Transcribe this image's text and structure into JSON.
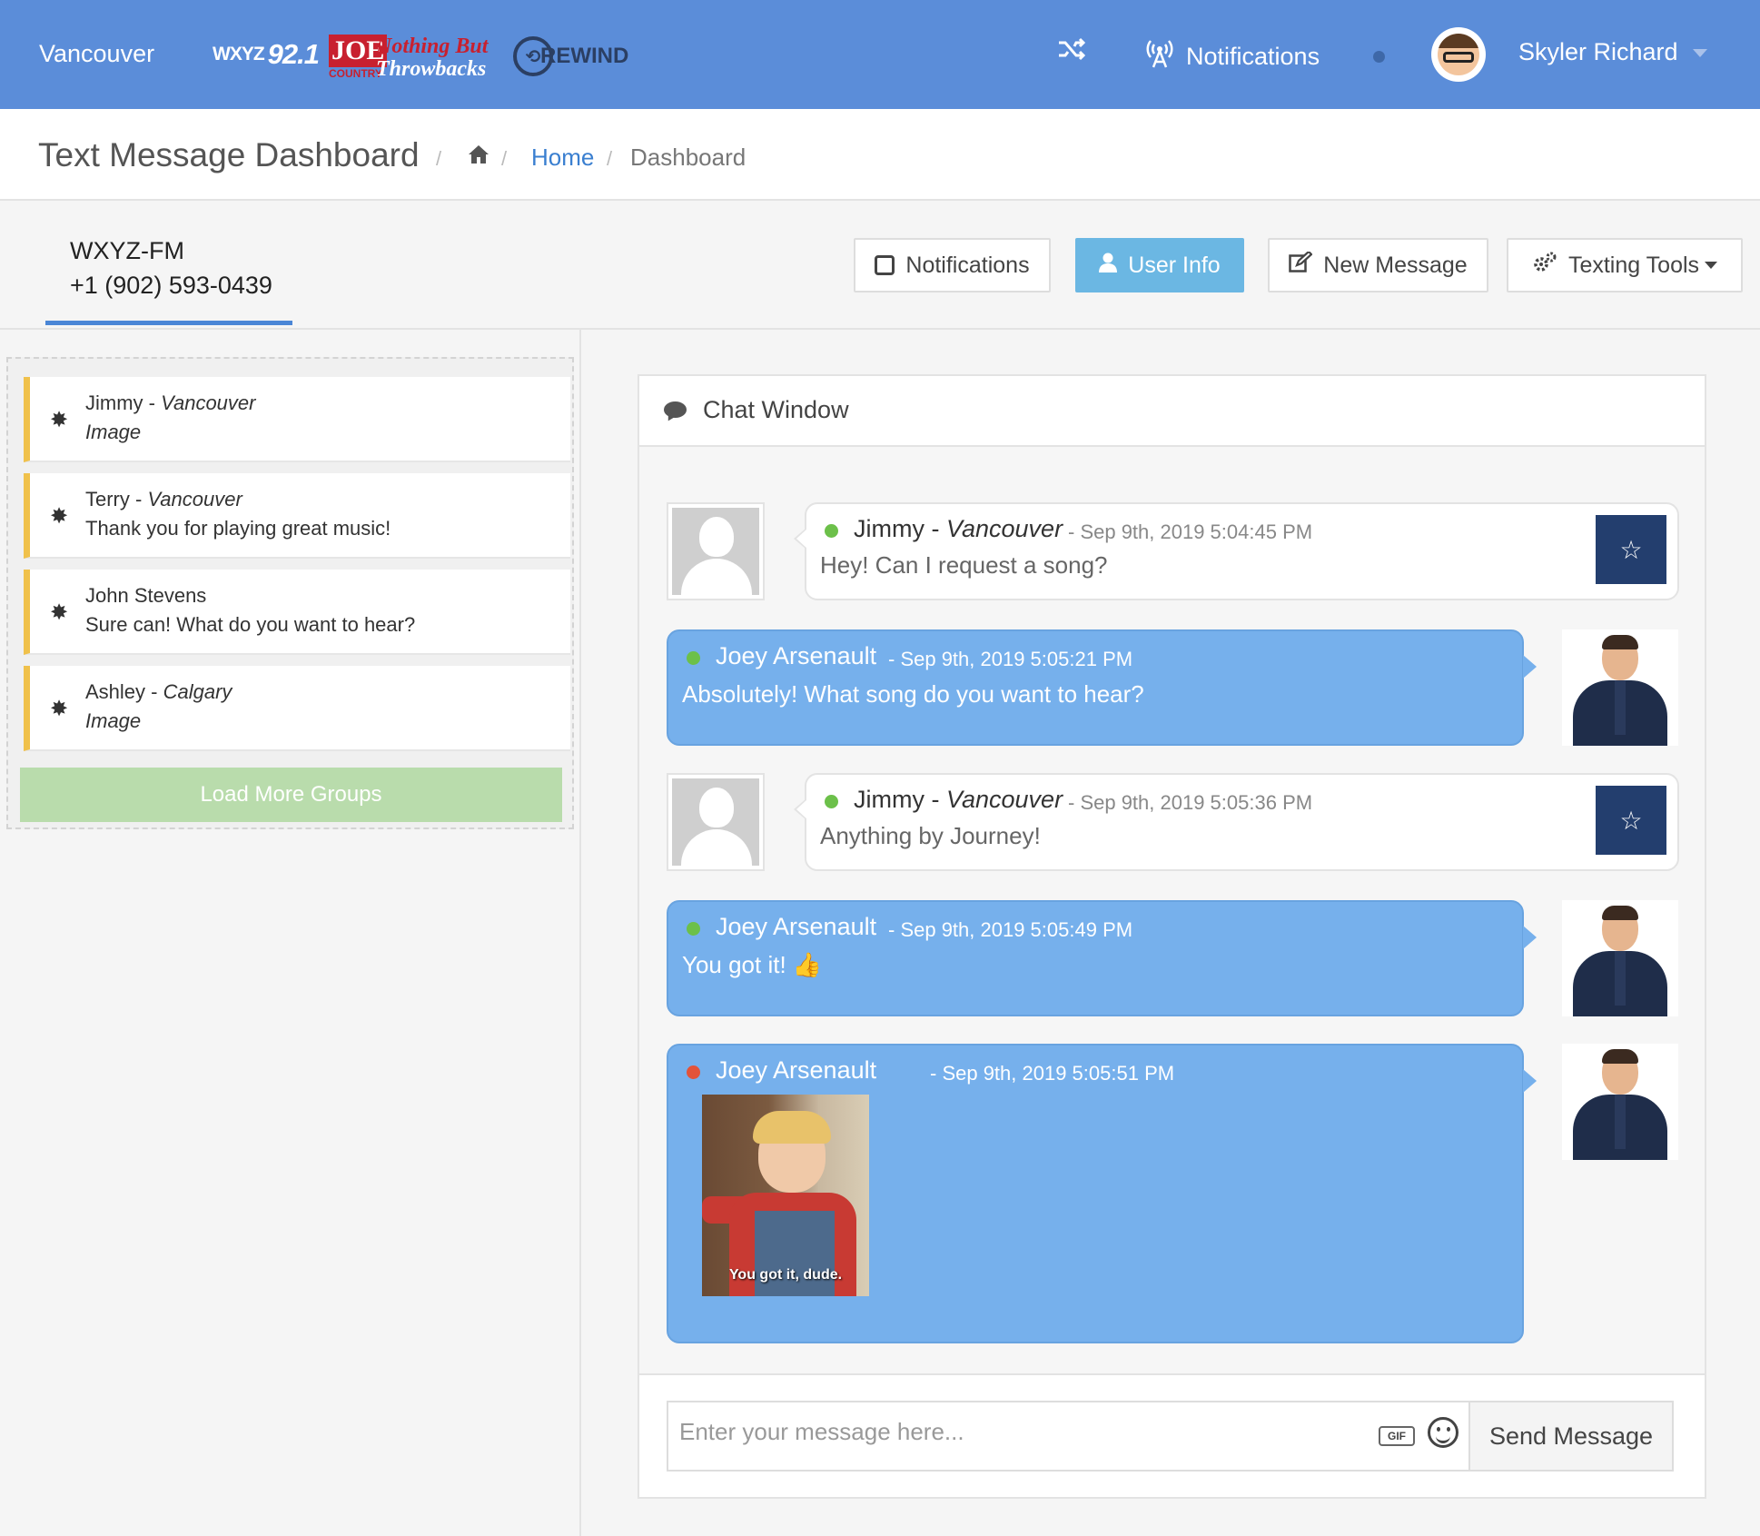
{
  "topbar": {
    "city": "Vancouver",
    "logos": {
      "wxyz": {
        "prefix": "WXYZ",
        "freq": "92.1"
      },
      "joe": {
        "brand": "JOE",
        "sub": "COUNTRY",
        "line1": "Nothing But",
        "line2": "Throwbacks"
      },
      "rewind": {
        "mark": "⟲",
        "name": "REWIND"
      }
    },
    "shuffle_icon": "shuffle-icon",
    "notifications_label": "Notifications",
    "notifications_icon": "broadcast-icon",
    "user_name": "Skyler Richard",
    "colors": {
      "bar": "#5b8dd9"
    }
  },
  "header": {
    "title": "Text Message Dashboard",
    "breadcrumb": {
      "home": "Home",
      "current": "Dashboard"
    }
  },
  "station": {
    "name": "WXYZ-FM",
    "phone": "+1 (902) 593-0439"
  },
  "toolbar": {
    "notifications": "Notifications",
    "user_info": "User Info",
    "new_message": "New Message",
    "texting_tools": "Texting Tools"
  },
  "groups": {
    "items": [
      {
        "name": "Jimmy",
        "sep": " - ",
        "location": "Vancouver",
        "preview": "Image",
        "preview_italic": true
      },
      {
        "name": "Terry",
        "sep": " - ",
        "location": "Vancouver",
        "preview": "Thank you for playing great music!",
        "preview_italic": false
      },
      {
        "name": "John Stevens",
        "sep": "",
        "location": "",
        "preview": "Sure can! What do you want to hear?",
        "preview_italic": false
      },
      {
        "name": "Ashley",
        "sep": " - ",
        "location": "Calgary",
        "preview": "Image",
        "preview_italic": true
      }
    ],
    "load_more": "Load More Groups",
    "accent": "#f0c14b"
  },
  "chat": {
    "title": "Chat Window",
    "messages": [
      {
        "direction": "in",
        "name": "Jimmy",
        "location": "Vancouver",
        "time": "- Sep 9th, 2019 5:04:45 PM",
        "text": "Hey! Can I request a song?",
        "status": "online"
      },
      {
        "direction": "out",
        "name": "Joey Arsenault",
        "time": "- Sep 9th, 2019 5:05:21 PM",
        "text": "Absolutely! What song do you want to hear?",
        "status": "online"
      },
      {
        "direction": "in",
        "name": "Jimmy",
        "location": "Vancouver",
        "time": "- Sep 9th, 2019 5:05:36 PM",
        "text": "Anything by Journey!",
        "status": "online"
      },
      {
        "direction": "out",
        "name": "Joey Arsenault",
        "time": "- Sep 9th, 2019 5:05:49 PM",
        "text": "You got it! 👍",
        "status": "online"
      },
      {
        "direction": "out",
        "name": "Joey Arsenault",
        "time": "- Sep 9th, 2019 5:05:51 PM",
        "gif_caption": "You got it, dude.",
        "status": "offline"
      }
    ],
    "name_sep": " - ",
    "compose_placeholder": "Enter your message here...",
    "gif_label": "GIF",
    "send_label": "Send Message",
    "colors": {
      "outgoing": "#76b0ec",
      "star_bg": "#233e6e",
      "online": "#6cc04a",
      "offline": "#e3533a"
    }
  }
}
